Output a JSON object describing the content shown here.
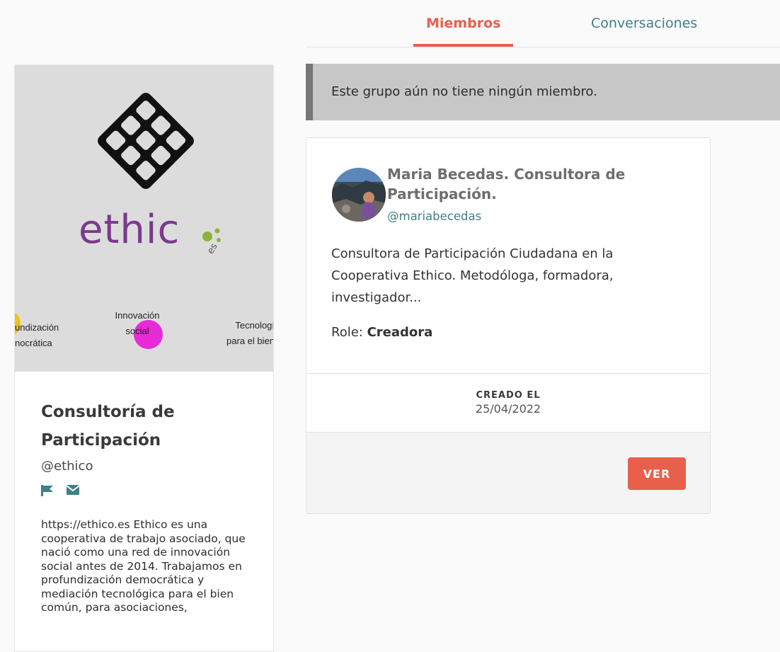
{
  "tabs": [
    {
      "label": "Miembros",
      "active": true
    },
    {
      "label": "Conversaciones",
      "active": false
    }
  ],
  "group": {
    "logo_text": "ethic",
    "logo_suffix": "es",
    "banner_labels": {
      "left": [
        "undización",
        "nocrática"
      ],
      "center": [
        "Innovación",
        "social"
      ],
      "right": [
        "Tecnologí",
        "para el bien"
      ]
    },
    "title": "Consultoría de Participación",
    "handle": "@ethico",
    "icons": [
      "flag-icon",
      "envelope-icon"
    ],
    "description": "https://ethico.es Ethico es una cooperativa de trabajo asociado, que nació como una red de innovación social antes de 2014. Trabajamos en profundización democrática y mediación tecnológica para el bien común, para asociaciones,"
  },
  "notice": {
    "text": "Este grupo aún no tiene ningún miembro."
  },
  "member": {
    "name": "Maria Becedas. Consultora de Participación.",
    "handle": "@mariabecedas",
    "description": "Consultora de Participación Ciudadana en la Cooperativa Ethico. Metodóloga, formadora, investigador...",
    "role_label": "Role:",
    "role_value": "Creadora",
    "created_label": "CREADO EL",
    "created_date": "25/04/2022",
    "button_label": "VER"
  },
  "colors": {
    "accent": "#e8604c",
    "link": "#3f7f85",
    "logo_purple": "#7b3a8c",
    "logo_green": "#8db33a"
  }
}
